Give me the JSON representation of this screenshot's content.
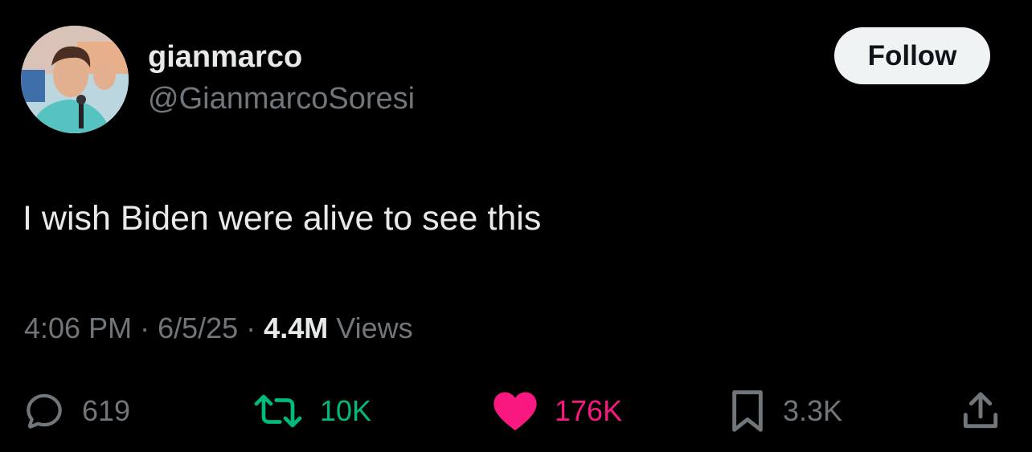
{
  "user": {
    "display_name": "gianmarco",
    "handle": "@GianmarcoSoresi"
  },
  "follow_label": "Follow",
  "tweet": {
    "text": "I wish Biden were alive to see this"
  },
  "meta": {
    "time": "4:06 PM",
    "separator": " · ",
    "date": "6/5/25",
    "views_count": "4.4M",
    "views_label": "Views"
  },
  "actions": {
    "replies": "619",
    "retweets": "10K",
    "likes": "176K",
    "bookmarks": "3.3K"
  },
  "colors": {
    "background": "#000000",
    "text_primary": "#e7e9ea",
    "text_secondary": "#71767b",
    "retweet_green": "#00ba7c",
    "like_pink": "#f91880",
    "follow_bg": "#eff3f4"
  },
  "icons": {
    "reply": "speech-bubble-icon",
    "retweet": "retweet-arrows-icon",
    "like": "filled-heart-icon",
    "bookmark": "bookmark-icon",
    "share": "share-upload-icon"
  }
}
